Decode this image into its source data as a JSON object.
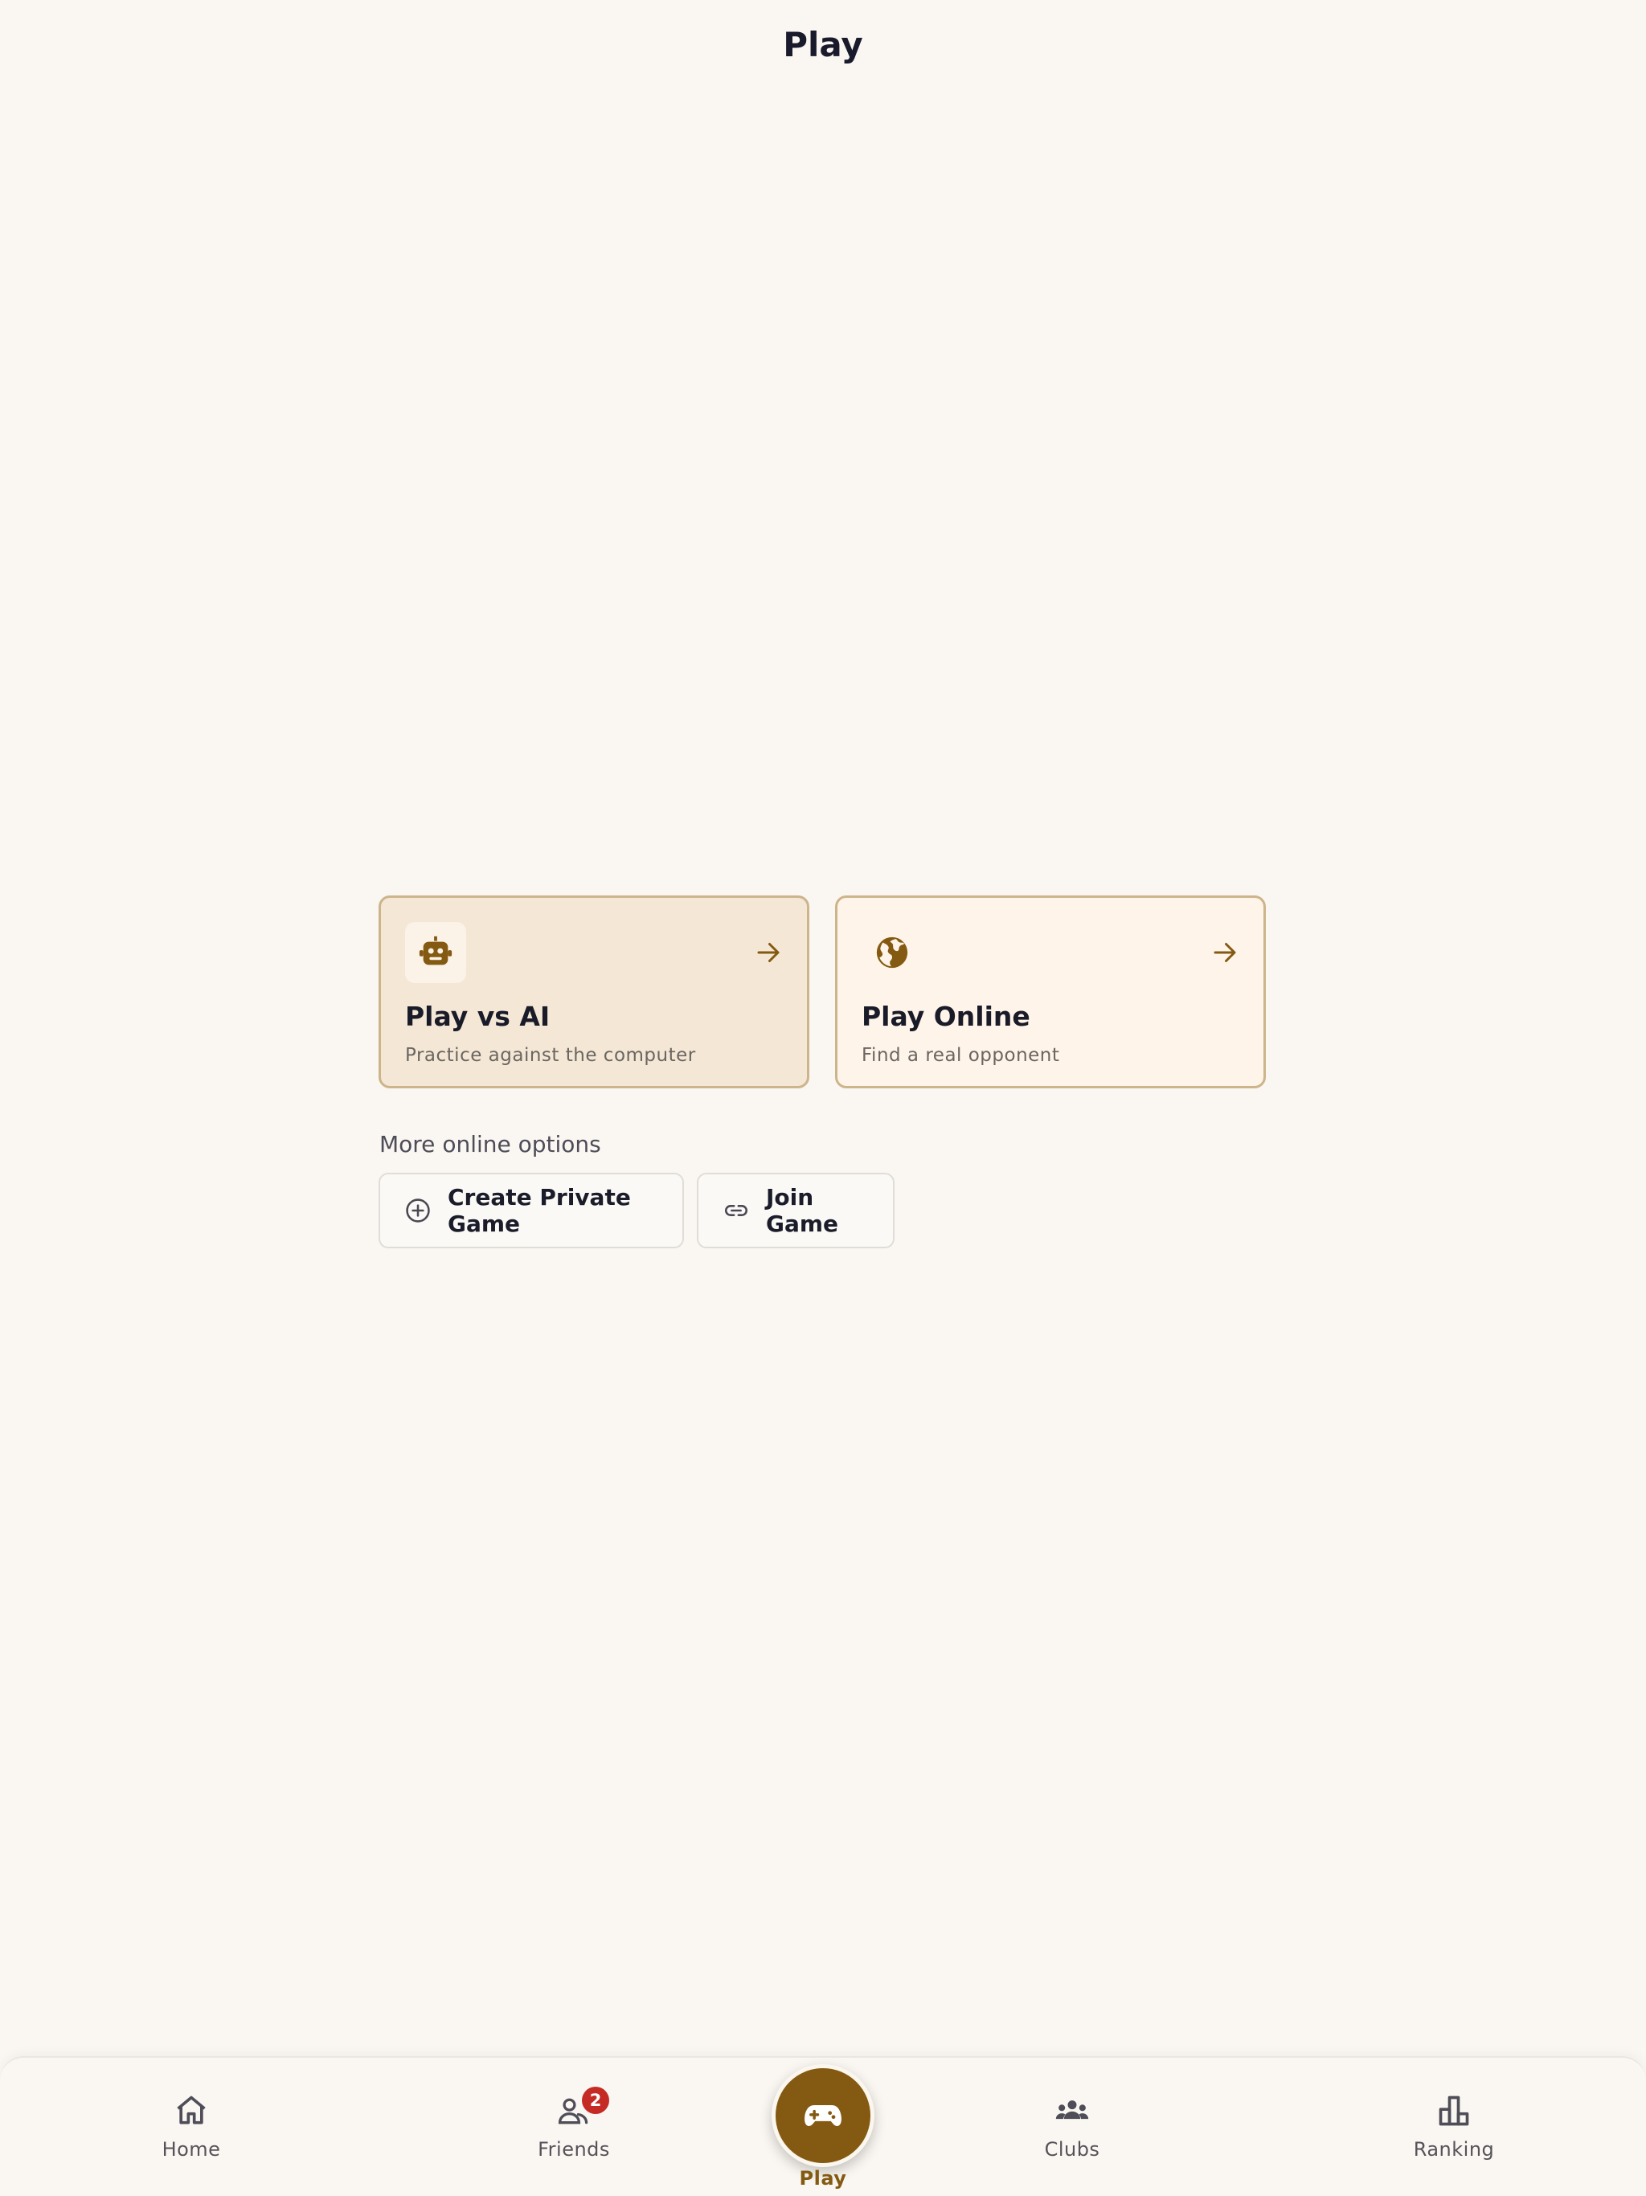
{
  "header": {
    "title": "Play"
  },
  "modes": [
    {
      "title": "Play vs AI",
      "subtitle": "Practice against the computer",
      "icon": "robot-icon"
    },
    {
      "title": "Play Online",
      "subtitle": "Find a real opponent",
      "icon": "globe-icon"
    }
  ],
  "more_options": {
    "label": "More online options",
    "create_label": "Create Private Game",
    "join_label": "Join Game"
  },
  "nav": {
    "home": "Home",
    "friends": "Friends",
    "friends_badge": "2",
    "play": "Play",
    "clubs": "Clubs",
    "ranking": "Ranking"
  },
  "colors": {
    "accent": "#845a12",
    "badge": "#c52a25",
    "background": "#faf7f2",
    "card_ai_bg": "#f4e7d5",
    "card_online_bg": "#fff4e9"
  }
}
